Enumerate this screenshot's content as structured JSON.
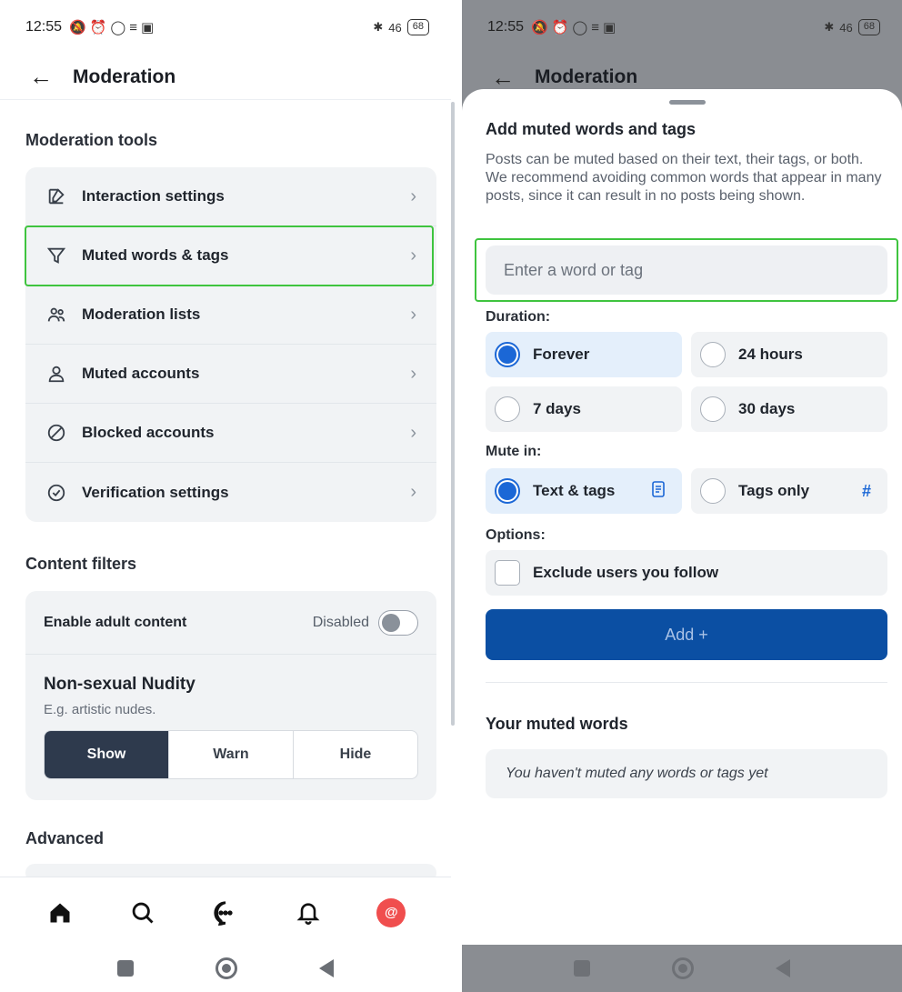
{
  "left": {
    "status": {
      "time": "12:55",
      "icons": "🔕⏰◯≡▣",
      "signal": "46",
      "battery": "68"
    },
    "header": {
      "title": "Moderation"
    },
    "sections": {
      "tools_title": "Moderation tools",
      "filters_title": "Content filters",
      "advanced_title": "Advanced"
    },
    "tools": [
      {
        "label": "Interaction settings",
        "icon": "edit-icon"
      },
      {
        "label": "Muted words & tags",
        "icon": "filter-icon"
      },
      {
        "label": "Moderation lists",
        "icon": "people-icon"
      },
      {
        "label": "Muted accounts",
        "icon": "person-icon"
      },
      {
        "label": "Blocked accounts",
        "icon": "block-icon"
      },
      {
        "label": "Verification settings",
        "icon": "check-circle-icon"
      }
    ],
    "content_filters": {
      "adult_label": "Enable adult content",
      "adult_state": "Disabled",
      "nudity_title": "Non-sexual Nudity",
      "nudity_desc": "E.g. artistic nudes.",
      "options": [
        "Show",
        "Warn",
        "Hide"
      ],
      "selected": "Show"
    },
    "tabbar": [
      "home-icon",
      "search-icon",
      "chat-icon",
      "bell-icon",
      "profile-avatar"
    ],
    "avatar_glyph": "@"
  },
  "right": {
    "status": {
      "time": "12:55",
      "icons": "🔕⏰◯≡▣",
      "signal": "46",
      "battery": "68"
    },
    "header": {
      "title": "Moderation"
    },
    "sheet": {
      "title": "Add muted words and tags",
      "description": "Posts can be muted based on their text, their tags, or both. We recommend avoiding common words that appear in many posts, since it can result in no posts being shown.",
      "input_placeholder": "Enter a word or tag",
      "duration_label": "Duration:",
      "durations": [
        "Forever",
        "24 hours",
        "7 days",
        "30 days"
      ],
      "duration_selected": "Forever",
      "mute_in_label": "Mute in:",
      "mute_in": [
        "Text & tags",
        "Tags only"
      ],
      "mute_in_selected": "Text & tags",
      "options_label": "Options:",
      "exclude_label": "Exclude users you follow",
      "add_button": "Add +",
      "muted_title": "Your muted words",
      "empty_text": "You haven't muted any words or tags yet"
    }
  },
  "colors": {
    "accent": "#1b67d6",
    "add_button": "#0b4fa3",
    "highlight": "#3fc43f",
    "segment_active": "#2e3a4d"
  }
}
